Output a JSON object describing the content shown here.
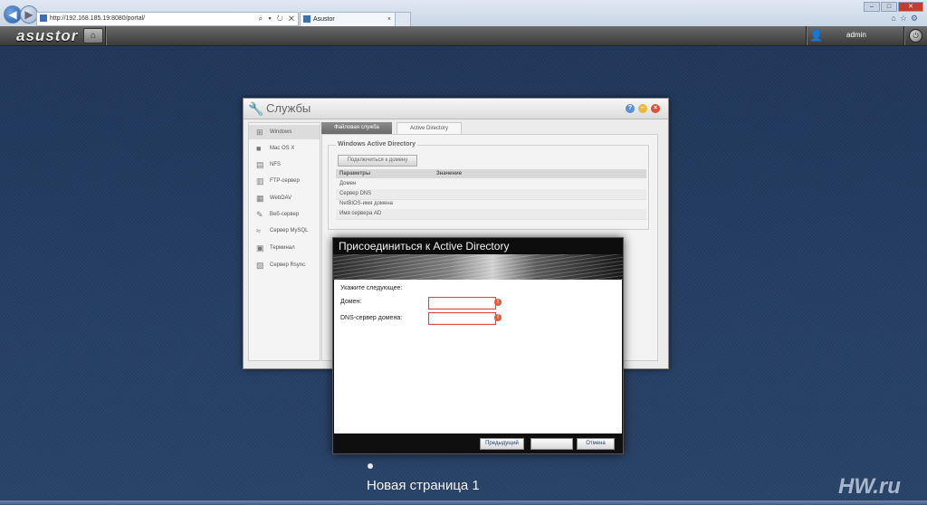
{
  "browser": {
    "url": "http://192.168.185.19:8080/portal/",
    "tab_title": "Asustor",
    "tab_close": "×",
    "address_controls": "⌕ ▾ ↻ ✕"
  },
  "app_header": {
    "logo": "asustor",
    "username": "admin"
  },
  "services_window": {
    "title": "Службы",
    "sidebar": [
      {
        "label": "Windows",
        "icon": "windows-icon"
      },
      {
        "label": "Mac OS X",
        "icon": "apple-icon"
      },
      {
        "label": "NFS",
        "icon": "nfs-icon"
      },
      {
        "label": "FTP-сервер",
        "icon": "ftp-icon"
      },
      {
        "label": "WebDAV",
        "icon": "webdav-icon"
      },
      {
        "label": "Веб-сервер",
        "icon": "web-server-icon"
      },
      {
        "label": "Сервер MySQL",
        "icon": "mysql-icon"
      },
      {
        "label": "Терминал",
        "icon": "terminal-icon"
      },
      {
        "label": "Сервер Rsync",
        "icon": "rsync-icon"
      }
    ],
    "tabs": [
      {
        "label": "Файловая служба"
      },
      {
        "label": "Active Directory"
      }
    ],
    "group_title": "Windows Active Directory",
    "join_button": "Подключиться к домену",
    "table": {
      "headers": [
        "Параметры",
        "Значение"
      ],
      "rows": [
        [
          "Домен",
          ""
        ],
        [
          "Сервер DNS",
          ""
        ],
        [
          "NetBIOS-имя домена",
          ""
        ],
        [
          "Имя сервера AD",
          ""
        ]
      ]
    }
  },
  "modal": {
    "title": "Присоединиться к Active Directory",
    "prompt": "Укажите следующее:",
    "fields": [
      {
        "label": "Домен:",
        "value": ""
      },
      {
        "label": "DNS-сервер домена:",
        "value": ""
      }
    ],
    "buttons": {
      "prev": "Предыдущий",
      "next": "",
      "cancel": "Отмена"
    }
  },
  "page_caption": "Новая страница 1",
  "watermark": "HW.ru",
  "colors": {
    "desktop": "#223a5c",
    "error_border": "#d94a3a",
    "link_blue": "#1c3f7a"
  }
}
